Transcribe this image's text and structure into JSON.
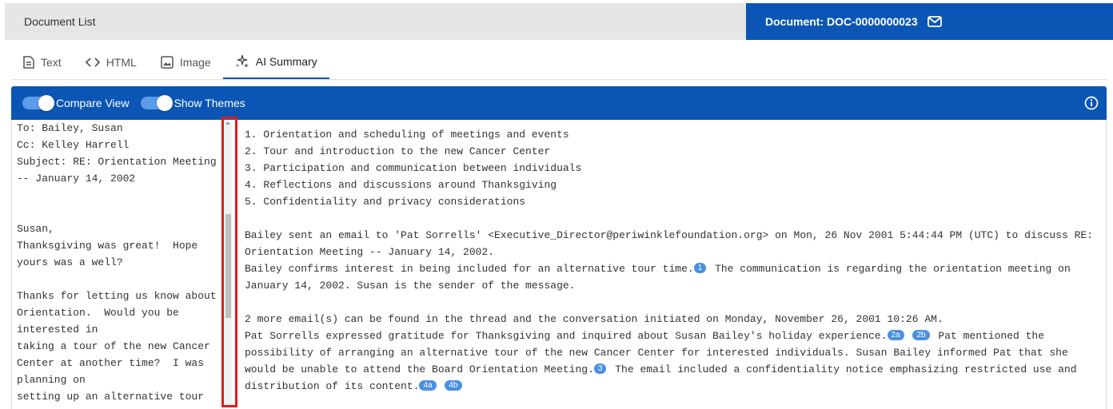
{
  "topbar": {
    "doc_list_label": "Document List",
    "doc_label": "Document: DOC-0000000023",
    "doc_icon": "mail-icon"
  },
  "view_tabs": [
    {
      "label": "Text",
      "icon": "file-text-icon"
    },
    {
      "label": "HTML",
      "icon": "code-icon"
    },
    {
      "label": "Image",
      "icon": "image-icon"
    },
    {
      "label": "AI Summary",
      "icon": "ai-sparkle-icon",
      "active": true
    }
  ],
  "panel": {
    "compare_view_label": "Compare View",
    "compare_view_on": true,
    "show_themes_label": "Show Themes",
    "show_themes_on": true,
    "info_icon": "info-icon"
  },
  "left_text": [
    "To: Bailey, Susan",
    "Cc: Kelley Harrell",
    "Subject: RE: Orientation Meeting",
    "-- January 14, 2002",
    "",
    "",
    "Susan,",
    "Thanksgiving was great!  Hope",
    "yours was a well?",
    "",
    "Thanks for letting us know about",
    "Orientation.  Would you be",
    "interested in",
    "taking a tour of the new Cancer",
    "Center at another time?  I was",
    "planning on",
    "setting up an alternative tour"
  ],
  "summary": {
    "themes": [
      "1. Orientation and scheduling of meetings and events",
      "2. Tour and introduction to the new Cancer Center",
      "3. Participation and communication between individuals",
      "4. Reflections and discussions around Thanksgiving",
      "5. Confidentiality and privacy considerations"
    ],
    "para1_intro": "Bailey sent an email to 'Pat Sorrells' <Executive_Director@periwinklefoundation.org> on Mon, 26 Nov 2001 5:44:44 PM (UTC) to discuss RE: Orientation Meeting -- January 14, 2002.",
    "para1_sentence1": "Bailey confirms interest in being included for an alternative tour time.",
    "badge_1": "1",
    "para1_sentence2": " The communication is regarding the orientation meeting on January 14, 2002. Susan is the sender of the message.",
    "para2_intro": "2 more email(s) can be found in the thread and the conversation initiated on Monday, November 26, 2001 10:26 AM.",
    "para2_sentence1": "Pat Sorrells expressed gratitude for Thanksgiving and inquired about Susan Bailey's holiday experience.",
    "badge_2a": "2a",
    "badge_2b": "2b",
    "para2_sentence2": " Pat mentioned the possibility of arranging an alternative tour of the new Cancer Center for interested individuals. Susan Bailey informed Pat that she would be unable to attend the Board Orientation Meeting.",
    "badge_3": "3",
    "para2_sentence3": " The email included a confidentiality notice emphasizing restricted use and distribution of its content.",
    "badge_4a": "4a",
    "badge_4b": "4b"
  },
  "colors": {
    "brand_blue": "#0b56b5",
    "badge_blue": "#4a90e2",
    "highlight_red": "#e01b1b"
  }
}
